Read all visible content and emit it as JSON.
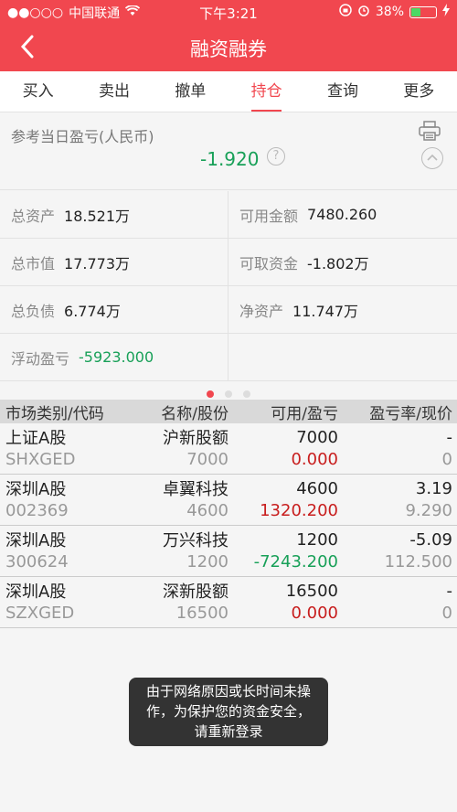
{
  "status_bar": {
    "signal": "●●○○○",
    "carrier": "中国联通",
    "time": "下午3:21",
    "battery_percent": "38%",
    "battery_level": 0.38,
    "accent_color": "#f1474f"
  },
  "nav": {
    "title": "融资融券",
    "back_icon": "chevron-left-icon"
  },
  "tabs": [
    {
      "label": "买入",
      "active": false
    },
    {
      "label": "卖出",
      "active": false
    },
    {
      "label": "撤单",
      "active": false
    },
    {
      "label": "持仓",
      "active": true
    },
    {
      "label": "查询",
      "active": false
    },
    {
      "label": "更多",
      "active": false
    }
  ],
  "summary": {
    "label": "参考当日盈亏(人民币)",
    "value": "-1.920",
    "help": "?"
  },
  "assets": {
    "total_assets_label": "总资产",
    "total_assets": "18.521万",
    "available_label": "可用金额",
    "available": "7480.260",
    "market_value_label": "总市值",
    "market_value": "17.773万",
    "withdrawable_label": "可取资金",
    "withdrawable": "-1.802万",
    "liabilities_label": "总负债",
    "liabilities": "6.774万",
    "net_assets_label": "净资产",
    "net_assets": "11.747万",
    "floating_pl_label": "浮动盈亏",
    "floating_pl": "-5923.000"
  },
  "table": {
    "headers": [
      "市场类别/代码",
      "名称/股份",
      "可用/盈亏",
      "盈亏率/现价"
    ],
    "rows": [
      {
        "market": "上证A股",
        "code": "SHXGED",
        "name": "沪新股额",
        "shares": "7000",
        "available": "7000",
        "pl": "0.000",
        "pl_rate": "-",
        "price": "0"
      },
      {
        "market": "深圳A股",
        "code": "002369",
        "name": "卓翼科技",
        "shares": "4600",
        "available": "4600",
        "pl": "1320.200",
        "pl_rate": "3.19",
        "price": "9.290"
      },
      {
        "market": "深圳A股",
        "code": "300624",
        "name": "万兴科技",
        "shares": "1200",
        "available": "1200",
        "pl": "-7243.200",
        "pl_rate": "-5.09",
        "price": "112.500"
      },
      {
        "market": "深圳A股",
        "code": "SZXGED",
        "name": "深新股额",
        "shares": "16500",
        "available": "16500",
        "pl": "0.000",
        "pl_rate": "-",
        "price": "0"
      }
    ]
  },
  "toast": {
    "line1": "由于网络原因或长时间未操",
    "line2": "作，为保护您的资金安全，",
    "line3": "请重新登录"
  }
}
